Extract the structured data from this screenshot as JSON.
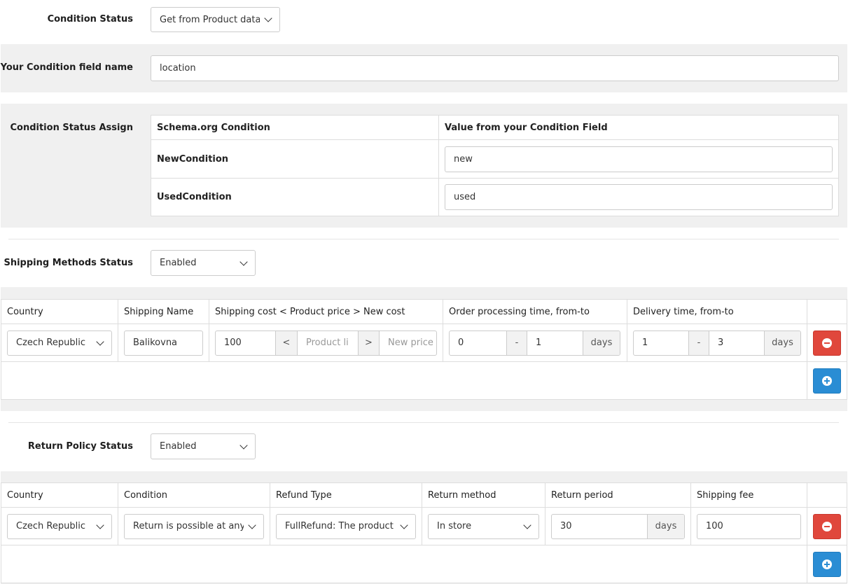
{
  "condition_status": {
    "label": "Condition Status",
    "value": "Get from Product data"
  },
  "condition_field": {
    "label": "Your Condition field name",
    "value": "location"
  },
  "condition_assign": {
    "label": "Condition Status Assign",
    "headers": [
      "Schema.org Condition",
      "Value from your Condition Field"
    ],
    "rows": [
      {
        "condition": "NewCondition",
        "value": "new"
      },
      {
        "condition": "UsedCondition",
        "value": "used"
      }
    ]
  },
  "shipping_status": {
    "label": "Shipping Methods Status",
    "value": "Enabled"
  },
  "shipping_table": {
    "headers": [
      "Country",
      "Shipping Name",
      "Shipping cost < Product price > New cost",
      "Order processing time, from-to",
      "Delivery time, from-to"
    ],
    "row": {
      "country": "Czech Republic",
      "name": "Balikovna",
      "cost": "100",
      "lt": "<",
      "price_placeholder": "Product li",
      "gt": ">",
      "new_price_placeholder": "New price",
      "proc_from": "0",
      "dash1": "-",
      "proc_to": "1",
      "proc_unit": "days",
      "del_from": "1",
      "dash2": "-",
      "del_to": "3",
      "del_unit": "days"
    }
  },
  "return_status": {
    "label": "Return Policy Status",
    "value": "Enabled"
  },
  "return_table": {
    "headers": [
      "Country",
      "Condition",
      "Refund Type",
      "Return method",
      "Return period",
      "Shipping fee"
    ],
    "row": {
      "country": "Czech Republic",
      "condition": "Return is possible at any",
      "refund": "FullRefund: The product c",
      "method": "In store",
      "period": "30",
      "period_unit": "days",
      "fee": "100"
    }
  },
  "colors": {
    "remove": "#e0473c",
    "add": "#2a8dd4",
    "panel": "#f0f0f0"
  }
}
